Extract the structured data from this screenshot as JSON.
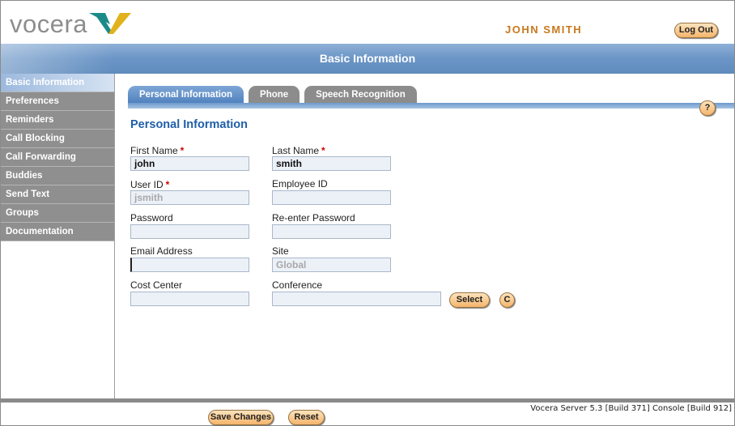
{
  "header": {
    "logo_text": "vocera",
    "user_name": "JOHN SMITH",
    "logout_label": "Log Out",
    "brand_colors": {
      "teal": "#1d8a8a",
      "gold": "#e2b21c",
      "orange": "#c8781c"
    }
  },
  "title": "Basic Information",
  "sidebar": {
    "items": [
      {
        "label": "Basic Information",
        "active": true
      },
      {
        "label": "Preferences"
      },
      {
        "label": "Reminders"
      },
      {
        "label": "Call Blocking"
      },
      {
        "label": "Call Forwarding"
      },
      {
        "label": "Buddies"
      },
      {
        "label": "Send Text"
      },
      {
        "label": "Groups"
      },
      {
        "label": "Documentation"
      }
    ]
  },
  "tabs": [
    {
      "label": "Personal Information",
      "active": true
    },
    {
      "label": "Phone"
    },
    {
      "label": "Speech Recognition"
    }
  ],
  "help_label": "?",
  "section_title": "Personal Information",
  "form": {
    "required_marker": "*",
    "first_name": {
      "label": "First Name",
      "value": "john"
    },
    "last_name": {
      "label": "Last Name",
      "value": "smith"
    },
    "user_id": {
      "label": "User ID",
      "value": "jsmith"
    },
    "employee_id": {
      "label": "Employee ID",
      "value": ""
    },
    "password": {
      "label": "Password",
      "value": ""
    },
    "reenter_password": {
      "label": "Re-enter Password",
      "value": ""
    },
    "email": {
      "label": "Email Address",
      "value": ""
    },
    "site": {
      "label": "Site",
      "value": "Global"
    },
    "cost_center": {
      "label": "Cost Center",
      "value": ""
    },
    "conference": {
      "label": "Conference",
      "value": ""
    },
    "select_label": "Select",
    "clear_label": "C"
  },
  "footer": {
    "save_label": "Save Changes",
    "reset_label": "Reset",
    "version": "Vocera Server 5.3 [Build 371] Console [Build 912]"
  }
}
